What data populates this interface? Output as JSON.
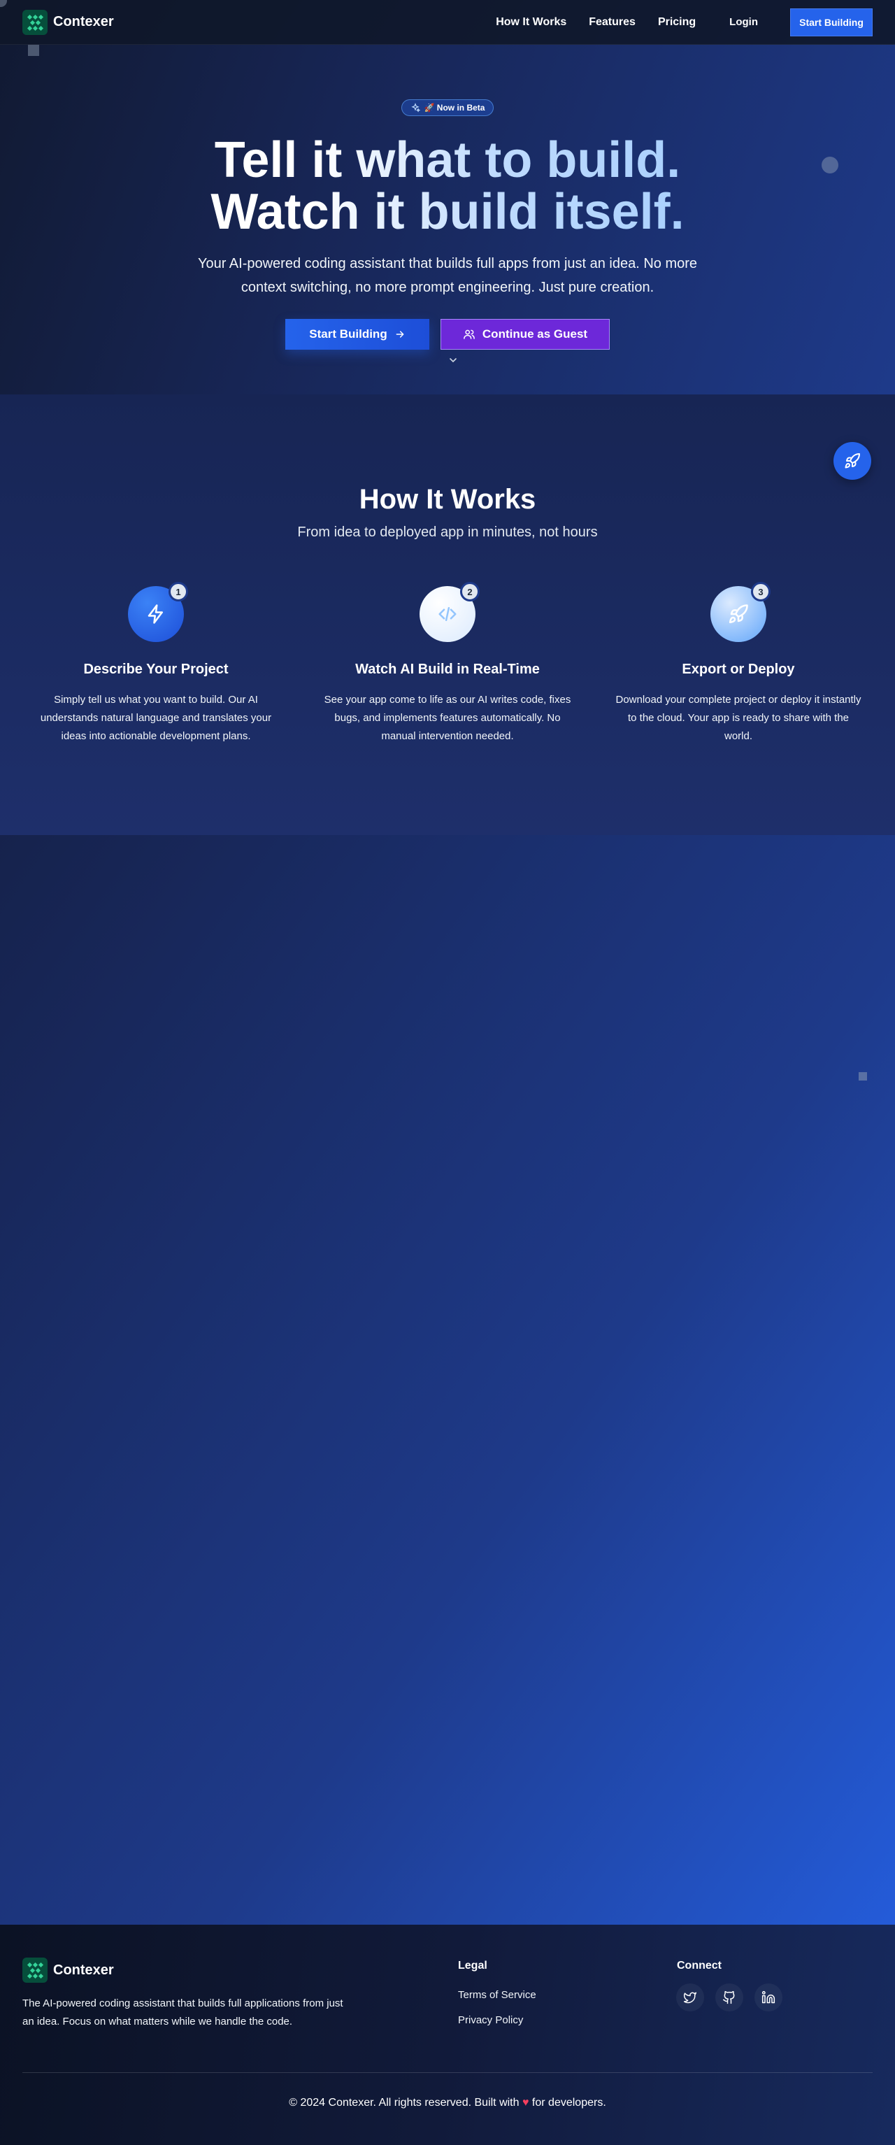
{
  "nav": {
    "brand": "Contexer",
    "links": [
      "How It Works",
      "Features",
      "Pricing"
    ],
    "login": "Login",
    "cta": "Start Building"
  },
  "hero": {
    "badge": "🚀 Now in Beta",
    "title_line1": "Tell it what to build.",
    "title_line2": "Watch it build itself.",
    "subtitle": "Your AI-powered coding assistant that builds full apps from just an idea. No more context switching, no more prompt engineering. Just pure creation.",
    "primary_button": "Start Building",
    "secondary_button": "Continue as Guest"
  },
  "how": {
    "title": "How It Works",
    "subtitle": "From idea to deployed app in minutes, not hours",
    "steps": [
      {
        "num": "1",
        "title": "Describe Your Project",
        "text": "Simply tell us what you want to build. Our AI understands natural language and translates your ideas into actionable development plans.",
        "icon": "lightning-icon"
      },
      {
        "num": "2",
        "title": "Watch AI Build in Real-Time",
        "text": "See your app come to life as our AI writes code, fixes bugs, and implements features automatically. No manual intervention needed.",
        "icon": "code-icon"
      },
      {
        "num": "3",
        "title": "Export or Deploy",
        "text": "Download your complete project or deploy it instantly to the cloud. Your app is ready to share with the world.",
        "icon": "rocket-icon"
      }
    ]
  },
  "footer": {
    "brand": "Contexer",
    "description": "The AI-powered coding assistant that builds full applications from just an idea. Focus on what matters while we handle the code.",
    "legal_title": "Legal",
    "legal_links": [
      "Terms of Service",
      "Privacy Policy"
    ],
    "connect_title": "Connect",
    "social": [
      "twitter-icon",
      "github-icon",
      "linkedin-icon"
    ],
    "copyright_before": "© 2024 Contexer. All rights reserved. Built with",
    "copyright_after": "for developers."
  },
  "colors": {
    "accent": "#2563eb",
    "secondary": "#6d28d9",
    "heart": "#f43f5e"
  }
}
